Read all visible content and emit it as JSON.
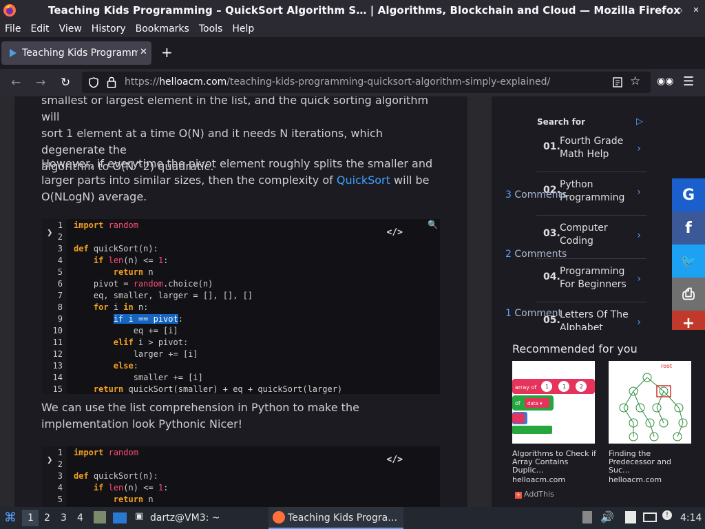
{
  "window": {
    "title": "Teaching Kids Programming – QuickSort Algorithm S… | Algorithms, Blockchain and Cloud — Mozilla Firefox"
  },
  "menu": [
    "File",
    "Edit",
    "View",
    "History",
    "Bookmarks",
    "Tools",
    "Help"
  ],
  "tab": {
    "label": "Teaching Kids Programmi",
    "close": "✕"
  },
  "newtab": "+",
  "url": {
    "scheme": "https://",
    "host": "helloacm.com",
    "path": "/teaching-kids-programming-quicksort-algorithm-simply-explained/"
  },
  "article": {
    "para1_lines": [
      "smallest or largest element in the list, and the quick sorting algorithm will",
      "sort 1 element at a time O(N) and it needs N iterations, which degenerate the",
      "algorithm to O(N^2) quadratic."
    ],
    "para2_a": "However, if everytime the pivot element roughly splits the smaller and larger parts into similar sizes, then the complexity of ",
    "para2_link": "QuickSort",
    "para2_b": " will be O(NLogN) average.",
    "para3": "We can use the list comprehension in Python to make the implementation look Pythonic Nicer!",
    "code1_lines": [
      {
        "n": "1",
        "parts": [
          [
            "kw",
            "import"
          ],
          [
            "",
            ""
          ],
          [
            "pk",
            " random"
          ]
        ]
      },
      {
        "n": "2",
        "parts": [
          [
            "",
            ""
          ]
        ]
      },
      {
        "n": "3",
        "parts": [
          [
            "kw",
            "def"
          ],
          [
            "",
            " quickSort(n):"
          ]
        ]
      },
      {
        "n": "4",
        "parts": [
          [
            "",
            "    "
          ],
          [
            "kw",
            "if"
          ],
          [
            "",
            " "
          ],
          [
            "pk",
            "len"
          ],
          [
            "",
            "(n) <= "
          ],
          [
            "pk",
            "1"
          ],
          [
            "",
            ":"
          ]
        ]
      },
      {
        "n": "5",
        "parts": [
          [
            "",
            "        "
          ],
          [
            "kw",
            "return"
          ],
          [
            "",
            " n"
          ]
        ]
      },
      {
        "n": "6",
        "parts": [
          [
            "",
            "    pivot = "
          ],
          [
            "pk",
            "random"
          ],
          [
            "",
            ".choice(n)"
          ]
        ]
      },
      {
        "n": "7",
        "parts": [
          [
            "",
            "    eq, smaller, larger = [], [], []"
          ]
        ]
      },
      {
        "n": "8",
        "parts": [
          [
            "",
            "    "
          ],
          [
            "kw",
            "for"
          ],
          [
            "",
            " i "
          ],
          [
            "kw",
            "in"
          ],
          [
            "",
            " n:"
          ]
        ]
      },
      {
        "n": "9",
        "parts": [
          [
            "",
            "        "
          ],
          [
            "sel",
            "if i == pivot"
          ],
          [
            "",
            ":"
          ]
        ]
      },
      {
        "n": "10",
        "parts": [
          [
            "",
            "            eq += [i]"
          ]
        ]
      },
      {
        "n": "11",
        "parts": [
          [
            "",
            "        "
          ],
          [
            "kw",
            "elif"
          ],
          [
            "",
            " i > pivot:"
          ]
        ]
      },
      {
        "n": "12",
        "parts": [
          [
            "",
            "            larger += [i]"
          ]
        ]
      },
      {
        "n": "13",
        "parts": [
          [
            "",
            "        "
          ],
          [
            "kw",
            "else"
          ],
          [
            "",
            ":"
          ]
        ]
      },
      {
        "n": "14",
        "parts": [
          [
            "",
            "            smaller += [i]"
          ]
        ]
      },
      {
        "n": "15",
        "parts": [
          [
            "",
            "    "
          ],
          [
            "kw",
            "return"
          ],
          [
            "",
            " quickSort(smaller) + eq + quickSort(larger)"
          ]
        ]
      }
    ],
    "code2_lines": [
      {
        "n": "1",
        "parts": [
          [
            "kw",
            "import"
          ],
          [
            "pk",
            " random"
          ]
        ]
      },
      {
        "n": "2",
        "parts": [
          [
            "",
            ""
          ]
        ]
      },
      {
        "n": "3",
        "parts": [
          [
            "kw",
            "def"
          ],
          [
            "",
            " quickSort(n):"
          ]
        ]
      },
      {
        "n": "4",
        "parts": [
          [
            "",
            "    "
          ],
          [
            "kw",
            "if"
          ],
          [
            "",
            " "
          ],
          [
            "pk",
            "len"
          ],
          [
            "",
            "(n) <= "
          ],
          [
            "pk",
            "1"
          ],
          [
            "",
            ":"
          ]
        ]
      },
      {
        "n": "5",
        "parts": [
          [
            "",
            "        "
          ],
          [
            "kw",
            "return"
          ],
          [
            "",
            " n"
          ]
        ]
      }
    ],
    "code_icon": "</>"
  },
  "sidebar": {
    "search_for": "Search for",
    "items": [
      {
        "num": "01.",
        "text": "Fourth Grade Math Help"
      },
      {
        "num": "02.",
        "text": "Python Programming"
      },
      {
        "num": "03.",
        "text": "Computer Coding"
      },
      {
        "num": "04.",
        "text": "Programming For Beginners"
      },
      {
        "num": "05.",
        "text": "Letters Of The Alphabet"
      }
    ],
    "comments": [
      {
        "num": "3",
        "label": " Comments"
      },
      {
        "num": "2",
        "label": " Comments"
      },
      {
        "num": "1",
        "label": " Comment"
      }
    ]
  },
  "social": [
    {
      "name": "google",
      "glyph": "G",
      "color": "#1a5fcc"
    },
    {
      "name": "facebook",
      "glyph": "f",
      "color": "#3b5998"
    },
    {
      "name": "twitter",
      "glyph": "🐦",
      "color": "#1da1f2"
    },
    {
      "name": "print",
      "glyph": "⎙",
      "color": "#707070"
    },
    {
      "name": "more",
      "glyph": "+",
      "color": "#c0392b"
    }
  ],
  "recommend": {
    "heading": "Recommended for you",
    "cards": [
      {
        "caption": "Algorithms to Check if Array Contains Duplic…",
        "source": "helloacm.com"
      },
      {
        "caption": "Finding the Predecessor and Suc…",
        "source": "helloacm.com"
      }
    ],
    "addthis": "AddThis"
  },
  "taskbar": {
    "workspaces": [
      "1",
      "2",
      "3",
      "4"
    ],
    "terminal": "dartz@VM3: ~",
    "firefox": "Teaching Kids Progra…",
    "clock": "4:14"
  }
}
